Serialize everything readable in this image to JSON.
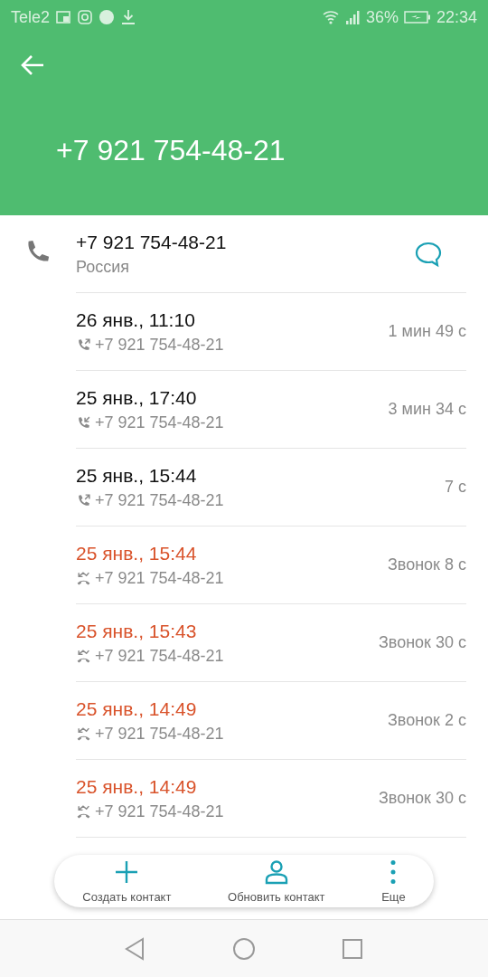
{
  "status_bar": {
    "carrier": "Tele2",
    "battery": "36%",
    "time": "22:34"
  },
  "header": {
    "title": "+7 921 754-48-21"
  },
  "contact": {
    "number": "+7 921 754-48-21",
    "region": "Россия"
  },
  "calls": [
    {
      "kind": "outgoing",
      "time": "26 янв., 11:10",
      "number": "+7 921 754-48-21",
      "duration": "1 мин 49 с"
    },
    {
      "kind": "incoming",
      "time": "25 янв., 17:40",
      "number": "+7 921 754-48-21",
      "duration": "3 мин 34 с"
    },
    {
      "kind": "outgoing",
      "time": "25 янв., 15:44",
      "number": "+7 921 754-48-21",
      "duration": "7 с"
    },
    {
      "kind": "missed",
      "time": "25 янв., 15:44",
      "number": "+7 921 754-48-21",
      "duration": "Звонок 8 с"
    },
    {
      "kind": "missed",
      "time": "25 янв., 15:43",
      "number": "+7 921 754-48-21",
      "duration": "Звонок 30 с"
    },
    {
      "kind": "missed",
      "time": "25 янв., 14:49",
      "number": "+7 921 754-48-21",
      "duration": "Звонок 2 с"
    },
    {
      "kind": "missed",
      "time": "25 янв., 14:49",
      "number": "+7 921 754-48-21",
      "duration": "Звонок 30 с"
    }
  ],
  "actions": [
    {
      "kind": "add",
      "label": "Создать контакт"
    },
    {
      "kind": "person",
      "label": "Обновить контакт"
    },
    {
      "kind": "more",
      "label": "Еще"
    }
  ]
}
